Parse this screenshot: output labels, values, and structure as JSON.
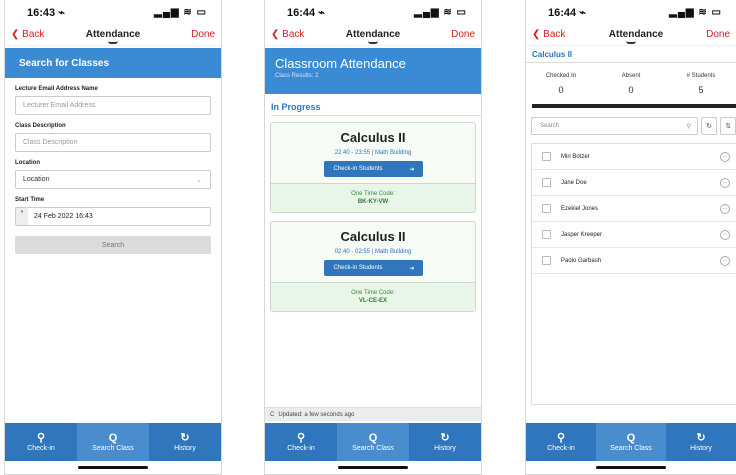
{
  "common": {
    "nav_title": "Attendance",
    "back_label": "Back",
    "done_label": "Done",
    "status_icons": "▂▄▆ ≋ ▭",
    "tabs": [
      {
        "label": "Check-in",
        "icon": "⚲"
      },
      {
        "label": "Search Class",
        "icon": "Q"
      },
      {
        "label": "History",
        "icon": "↻"
      }
    ]
  },
  "screen1": {
    "time": "16:43 ⌁",
    "header": "Search for Classes",
    "fields": [
      {
        "label": "Lecture Email Address Name",
        "placeholder": "Lecturer Email Address"
      },
      {
        "label": "Class Description",
        "placeholder": "Class Description"
      },
      {
        "label": "Location",
        "value": "Location"
      },
      {
        "label": "Start Time",
        "value": "24 Feb 2022 16:43"
      }
    ],
    "search_button": "Search",
    "active_tab": 1
  },
  "screen2": {
    "time": "16:44 ⌁",
    "header": "Classroom Attendance",
    "subheader": "Class Results: 2",
    "section": "In Progress",
    "classes": [
      {
        "name": "Calculus II",
        "details": "22:40 - 23:55 | Math Building",
        "button": "Check-in Students",
        "code_label": "One Time Code:",
        "code": "BK-KY-VW"
      },
      {
        "name": "Calculus II",
        "details": "02:40 - 02:55 | Math Building",
        "button": "Check-in Students",
        "code_label": "One Time Code:",
        "code": "VL-CE-EX"
      }
    ],
    "updated": "Updated: a few seconds ago",
    "active_tab": 1
  },
  "screen3": {
    "time": "16:44 ⌁",
    "section": "Calculus II",
    "stats": [
      {
        "label": "Checked In",
        "value": "0"
      },
      {
        "label": "Absent",
        "value": "0"
      },
      {
        "label": "# Students",
        "value": "5"
      }
    ],
    "search_placeholder": "Search",
    "students": [
      "Miri Botzer",
      "Jane Doe",
      "Ezekiel Jones",
      "Jasper Kreeper",
      "Paolo Garbash"
    ],
    "active_tab": 1
  }
}
